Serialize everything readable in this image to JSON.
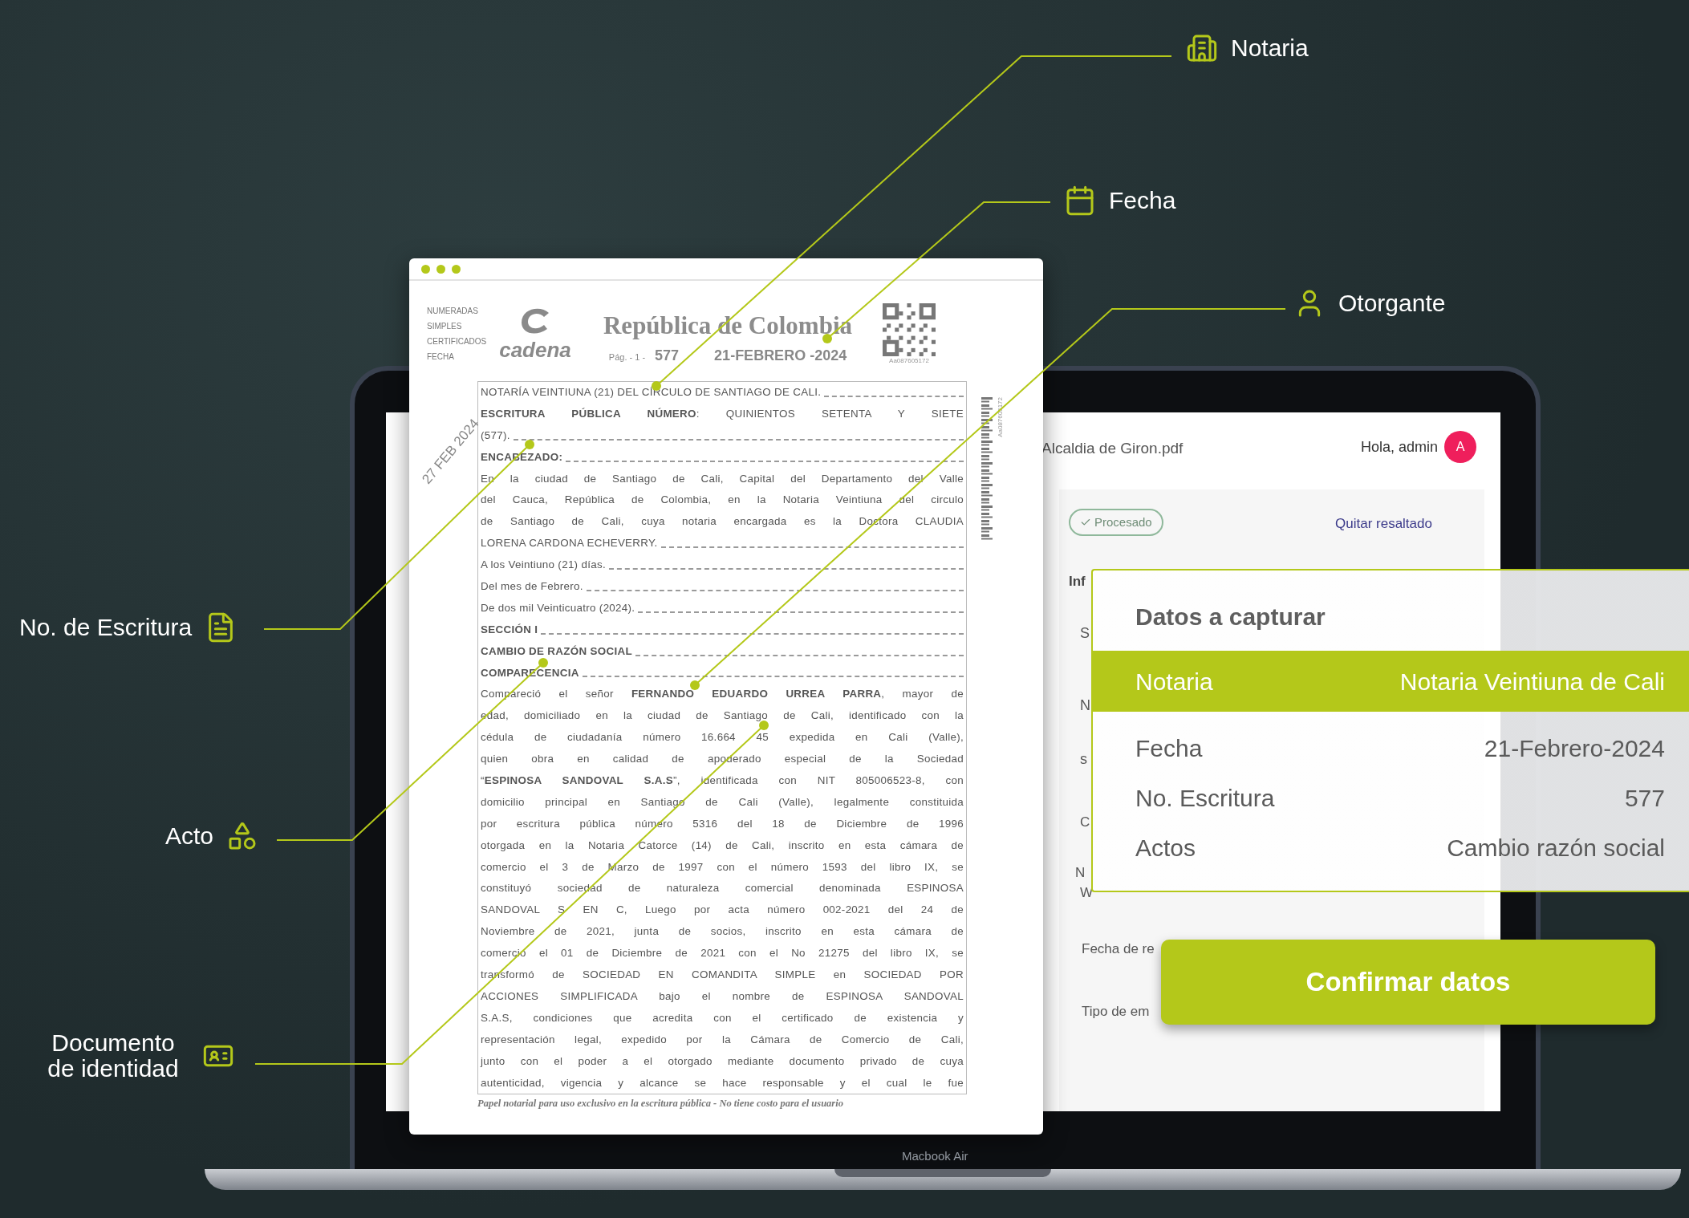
{
  "callouts": [
    {
      "label": "Notaria"
    },
    {
      "label": "Fecha"
    },
    {
      "label": "Otorgante"
    },
    {
      "label": "No. de Escritura"
    },
    {
      "label": "Acto"
    },
    {
      "label": "Documento de identidad"
    }
  ],
  "document": {
    "stamp_list": [
      "NUMERADAS",
      "SIMPLES",
      "CERTIFICADOS",
      "FECHA"
    ],
    "logo_text": "cadena",
    "title": "República de Colombia",
    "page": "Pág. - 1 -",
    "number": "577",
    "date": "21-FEBRERO -2024",
    "qr_code_id": "Aa087605172",
    "barcode_id": "Aa087605172",
    "received_stamp": "27 FEB 2024",
    "lines": [
      {
        "text": "NOTARÍA VEINTIUNA (21) DEL CÍRCULO DE SANTIAGO DE CALI.",
        "kind": "dash",
        "bold": false
      },
      {
        "text": "**ESCRITURA PÚBLICA NÚMERO**: QUINIENTOS SETENTA Y SIETE",
        "kind": "justify",
        "bold": false
      },
      {
        "text": "(577).",
        "kind": "dash",
        "bold": false
      },
      {
        "text": "ENCABEZADO:",
        "kind": "dash",
        "bold": true
      },
      {
        "text": "En la ciudad de Santiago de Cali, Capital del Departamento del Valle",
        "kind": "justify",
        "bold": false
      },
      {
        "text": "del Cauca, República de Colombia, en la Notaria Veintiuna del circulo",
        "kind": "justify",
        "bold": false
      },
      {
        "text": "de Santiago de Cali, cuya notaria encargada es la Doctora CLAUDIA",
        "kind": "justify",
        "bold": false
      },
      {
        "text": "LORENA CARDONA ECHEVERRY.",
        "kind": "dash",
        "bold": false
      },
      {
        "text": "A los Veintiuno (21) días.",
        "kind": "dash",
        "bold": false
      },
      {
        "text": "Del mes de Febrero.",
        "kind": "dash",
        "bold": false
      },
      {
        "text": "De dos mil Veinticuatro (2024).",
        "kind": "dash",
        "bold": false
      },
      {
        "text": "SECCIÓN I",
        "kind": "dash",
        "bold": true
      },
      {
        "text": "CAMBIO DE RAZÓN SOCIAL",
        "kind": "dash",
        "bold": true
      },
      {
        "text": "COMPARECENCIA",
        "kind": "dash",
        "bold": true
      },
      {
        "text": "Compareció el señor **FERNANDO EDUARDO URREA PARRA**, mayor de",
        "kind": "justify",
        "bold": false
      },
      {
        "text": "edad, domiciliado en la ciudad de Santiago de Cali, identificado con la",
        "kind": "justify",
        "bold": false
      },
      {
        "text": "cédula de ciudadanía número 16.664 45 expedida en Cali (Valle),",
        "kind": "justify",
        "bold": false
      },
      {
        "text": "quien obra en calidad de apoderado especial de la Sociedad",
        "kind": "justify",
        "bold": false
      },
      {
        "text": "“**ESPINOSA SANDOVAL S.A.S**”, identificada con NIT 805006523-8, con",
        "kind": "justify",
        "bold": false
      },
      {
        "text": "domicilio principal en Santiago de Cali (Valle), legalmente constituida",
        "kind": "justify",
        "bold": false
      },
      {
        "text": "por escritura pública número 5316 del 18 de Diciembre de 1996",
        "kind": "justify",
        "bold": false
      },
      {
        "text": "otorgada en la Notaria Catorce (14) de Cali, inscrito en esta cámara de",
        "kind": "justify",
        "bold": false
      },
      {
        "text": "comercio el 3 de Marzo de 1997 con el número 1593 del libro IX, se",
        "kind": "justify",
        "bold": false
      },
      {
        "text": "constituyó sociedad de naturaleza comercial denominada ESPINOSA",
        "kind": "justify",
        "bold": false
      },
      {
        "text": "SANDOVAL S EN C, Luego por acta número 002-2021 del 24 de",
        "kind": "justify",
        "bold": false
      },
      {
        "text": "Noviembre de 2021, junta de socios, inscrito en esta cámara de",
        "kind": "justify",
        "bold": false
      },
      {
        "text": "comercio el 01 de Diciembre de 2021 con el No 21275 del libro IX, se",
        "kind": "justify",
        "bold": false
      },
      {
        "text": "transformó de SOCIEDAD EN COMANDITA SIMPLE en SOCIEDAD POR",
        "kind": "justify",
        "bold": false
      },
      {
        "text": "ACCIONES SIMPLIFICADA bajo el nombre de ESPINOSA SANDOVAL",
        "kind": "justify",
        "bold": false
      },
      {
        "text": "S.A.S, condiciones que acredita con el certificado de existencia y",
        "kind": "justify",
        "bold": false
      },
      {
        "text": "representación legal, expedido por la Cámara de Comercio de Cali,",
        "kind": "justify",
        "bold": false
      },
      {
        "text": "junto con el poder a el otorgado mediante documento privado de cuya",
        "kind": "justify",
        "bold": false
      },
      {
        "text": "autenticidad, vigencia y alcance se hace responsable y el cual le fue",
        "kind": "justify",
        "bold": false
      }
    ],
    "footer": "Papel notarial para uso exclusivo en la escritura pública - No tiene costo para el usuario"
  },
  "app": {
    "file_name": "Alcaldia de Giron.pdf",
    "greeting": "Hola, admin",
    "avatar_initial": "A",
    "status_badge": "Procesado",
    "action_link": "Quitar resaltado",
    "section_title": "Inf",
    "form_texts": [
      "S",
      "N",
      "s",
      "C",
      "N",
      "W",
      "Fecha de re",
      "Tipo de em"
    ]
  },
  "capture_panel": {
    "title": "Datos a capturar",
    "rows": [
      {
        "label": "Notaria",
        "value": "Notaria Veintiuna de Cali",
        "selected": true
      },
      {
        "label": "Fecha",
        "value": "21-Febrero-2024",
        "selected": false
      },
      {
        "label": "No. Escritura",
        "value": "577",
        "selected": false
      },
      {
        "label": "Actos",
        "value": "Cambio razón social",
        "selected": false
      }
    ]
  },
  "confirm_button": "Confirmar datos",
  "device_label": "Macbook Air"
}
